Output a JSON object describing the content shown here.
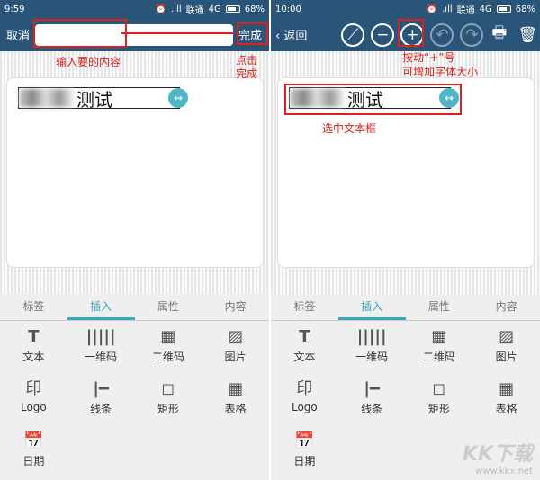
{
  "left": {
    "status": {
      "time": "9:59",
      "carrier": "联通",
      "network": "4G",
      "battery": "68%"
    },
    "header": {
      "cancel": "取消",
      "input_value": "",
      "done": "完成"
    },
    "textbox": {
      "text": "测试"
    },
    "annotations": {
      "input_hint": "输入要的内容",
      "done_hint": "点击\n完成"
    }
  },
  "right": {
    "status": {
      "time": "10:00",
      "carrier": "联通",
      "network": "4G",
      "battery": "68%"
    },
    "header": {
      "back": "返回"
    },
    "textbox": {
      "text": "测试"
    },
    "annotations": {
      "plus_hint_1": "按动“+”号",
      "plus_hint_2": "可增加字体大小",
      "select_hint": "选中文本框"
    }
  },
  "tabs": [
    "标签",
    "插入",
    "属性",
    "内容"
  ],
  "active_tab": "插入",
  "insert_items": [
    {
      "label": "文本",
      "icon": "text-icon"
    },
    {
      "label": "一维码",
      "icon": "barcode-icon"
    },
    {
      "label": "二维码",
      "icon": "qrcode-icon"
    },
    {
      "label": "图片",
      "icon": "image-icon"
    },
    {
      "label": "Logo",
      "icon": "logo-icon"
    },
    {
      "label": "线条",
      "icon": "line-icon"
    },
    {
      "label": "矩形",
      "icon": "rectangle-icon"
    },
    {
      "label": "表格",
      "icon": "table-icon"
    },
    {
      "label": "日期",
      "icon": "calendar-icon"
    }
  ],
  "watermark": {
    "brand": "KK下载",
    "url": "www.kkx.net"
  },
  "colors": {
    "header": "#2a5578",
    "accent": "#3aa8bb",
    "annotation": "#e0201c"
  }
}
